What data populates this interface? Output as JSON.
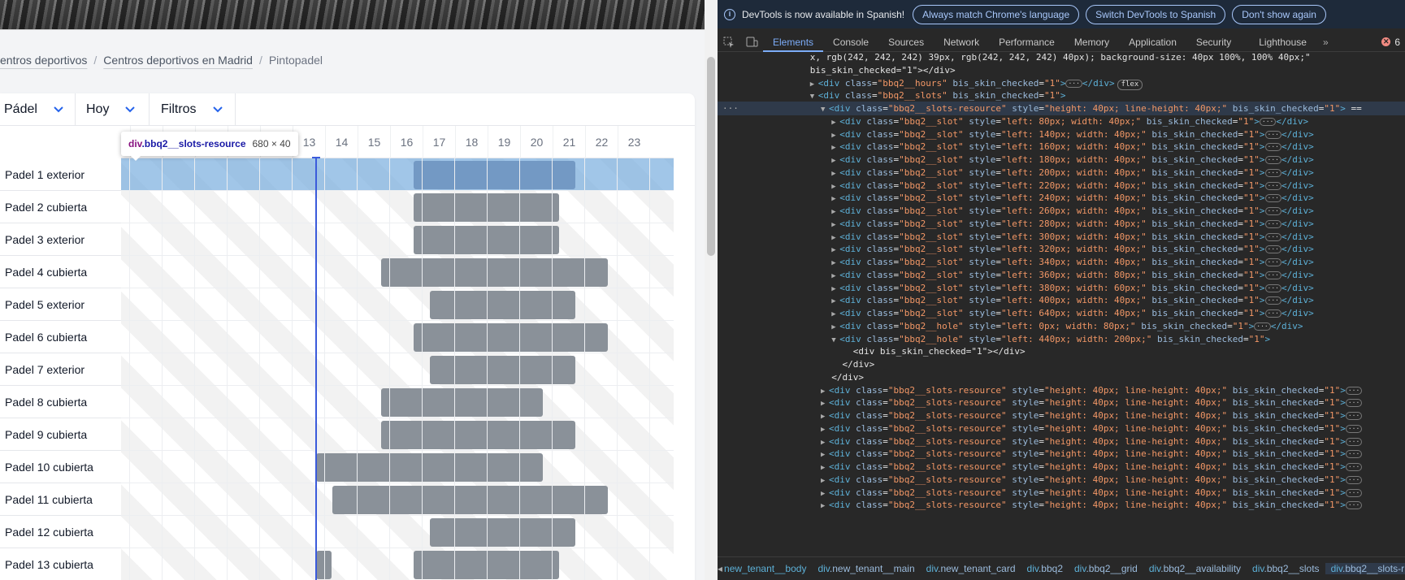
{
  "breadcrumb": {
    "items": [
      "entros deportivos",
      "Centros deportivos en Madrid",
      "Pintopadel"
    ],
    "separator": "/"
  },
  "filters": [
    {
      "label": "Pádel"
    },
    {
      "label": "Hoy"
    },
    {
      "label": "Filtros"
    }
  ],
  "hours": [
    "",
    "",
    "",
    "",
    "",
    "13",
    "14",
    "15",
    "16",
    "17",
    "18",
    "19",
    "20",
    "21",
    "22",
    "23"
  ],
  "resources": [
    "Padel 1 exterior",
    "Padel 2 cubierta",
    "Padel 3 exterior",
    "Padel 4 cubierta",
    "Padel 5 exterior",
    "Padel 6 cubierta",
    "Padel 7 exterior",
    "Padel 8 cubierta",
    "Padel 9 cubierta",
    "Padel 10 cubierta",
    "Padel 11 cubierta",
    "Padel 12 cubierta",
    "Padel 13 cubierta"
  ],
  "bookings": [
    [
      {
        "start": 18,
        "end": 23
      }
    ],
    [
      {
        "start": 18,
        "end": 22.5
      }
    ],
    [
      {
        "start": 18,
        "end": 22.5
      }
    ],
    [
      {
        "start": 17,
        "end": 24
      }
    ],
    [
      {
        "start": 18.5,
        "end": 23
      }
    ],
    [
      {
        "start": 18,
        "end": 24
      }
    ],
    [
      {
        "start": 18.5,
        "end": 23
      }
    ],
    [
      {
        "start": 17,
        "end": 22
      }
    ],
    [
      {
        "start": 17,
        "end": 23
      }
    ],
    [
      {
        "start": 15,
        "end": 22
      }
    ],
    [
      {
        "start": 15.5,
        "end": 24
      }
    ],
    [
      {
        "start": 18.5,
        "end": 23
      }
    ],
    [
      {
        "start": 15,
        "end": 15.5
      },
      {
        "start": 18,
        "end": 22.5
      }
    ]
  ],
  "now_hour": 15,
  "tooltip": {
    "tag": "div",
    "cls": ".bbq2__slots-resource",
    "dims": "680 × 40"
  },
  "devtools": {
    "infobar": {
      "message": "DevTools is now available in Spanish!",
      "buttons": [
        "Always match Chrome's language",
        "Switch DevTools to Spanish",
        "Don't show again"
      ]
    },
    "tabs": [
      "Elements",
      "Console",
      "Sources",
      "Network",
      "Performance",
      "Memory",
      "Application",
      "Security",
      "Lighthouse"
    ],
    "active_tab": "Elements",
    "error_count": "6",
    "dom_lines": [
      {
        "indent": 19,
        "text": "x, rgb(242, 242, 242) 39px, rgb(242, 242, 242) 40px); background-size: 40px 100%, 100% 40px;\"",
        "raw": true
      },
      {
        "indent": 19,
        "text": "bis_skin_checked=\"1\"></div>",
        "raw": true
      },
      {
        "indent": 19,
        "arrow": "▶",
        "cls": "bbq2__hours",
        "rest": " bis_skin_checked=\"1\">",
        "tail": "</div>",
        "ell": true,
        "flex": true
      },
      {
        "indent": 19,
        "arrow": "▼",
        "cls": "bbq2__slots",
        "rest": " bis_skin_checked=\"1\">"
      },
      {
        "indent": 21,
        "arrow": "▼",
        "cls": "bbq2__slots-resource",
        "style": "height: 40px; line-height: 40px;",
        "rest": " bis_skin_checked=\"1\"> ==",
        "selected": true
      },
      {
        "indent": 23,
        "arrow": "▶",
        "cls": "bbq2__slot",
        "style": "left: 80px; width: 40px;",
        "ell": true
      },
      {
        "indent": 23,
        "arrow": "▶",
        "cls": "bbq2__slot",
        "style": "left: 140px; width: 40px;",
        "ell": true
      },
      {
        "indent": 23,
        "arrow": "▶",
        "cls": "bbq2__slot",
        "style": "left: 160px; width: 40px;",
        "ell": true
      },
      {
        "indent": 23,
        "arrow": "▶",
        "cls": "bbq2__slot",
        "style": "left: 180px; width: 40px;",
        "ell": true
      },
      {
        "indent": 23,
        "arrow": "▶",
        "cls": "bbq2__slot",
        "style": "left: 200px; width: 40px;",
        "ell": true
      },
      {
        "indent": 23,
        "arrow": "▶",
        "cls": "bbq2__slot",
        "style": "left: 220px; width: 40px;",
        "ell": true
      },
      {
        "indent": 23,
        "arrow": "▶",
        "cls": "bbq2__slot",
        "style": "left: 240px; width: 40px;",
        "ell": true
      },
      {
        "indent": 23,
        "arrow": "▶",
        "cls": "bbq2__slot",
        "style": "left: 260px; width: 40px;",
        "ell": true
      },
      {
        "indent": 23,
        "arrow": "▶",
        "cls": "bbq2__slot",
        "style": "left: 280px; width: 40px;",
        "ell": true
      },
      {
        "indent": 23,
        "arrow": "▶",
        "cls": "bbq2__slot",
        "style": "left: 300px; width: 40px;",
        "ell": true
      },
      {
        "indent": 23,
        "arrow": "▶",
        "cls": "bbq2__slot",
        "style": "left: 320px; width: 40px;",
        "ell": true
      },
      {
        "indent": 23,
        "arrow": "▶",
        "cls": "bbq2__slot",
        "style": "left: 340px; width: 40px;",
        "ell": true
      },
      {
        "indent": 23,
        "arrow": "▶",
        "cls": "bbq2__slot",
        "style": "left: 360px; width: 80px;",
        "ell": true
      },
      {
        "indent": 23,
        "arrow": "▶",
        "cls": "bbq2__slot",
        "style": "left: 380px; width: 60px;",
        "ell": true
      },
      {
        "indent": 23,
        "arrow": "▶",
        "cls": "bbq2__slot",
        "style": "left: 400px; width: 40px;",
        "ell": true
      },
      {
        "indent": 23,
        "arrow": "▶",
        "cls": "bbq2__slot",
        "style": "left: 640px; width: 40px;",
        "ell": true
      },
      {
        "indent": 23,
        "arrow": "▶",
        "cls": "bbq2__hole",
        "style": "left: 0px; width: 80px;",
        "ell": true
      },
      {
        "indent": 23,
        "arrow": "▼",
        "cls": "bbq2__hole",
        "style": "left: 440px; width: 200px;",
        "rest": " bis_skin_checked=\"1\">"
      },
      {
        "indent": 27,
        "text": "<div bis_skin_checked=\"1\"></div>",
        "raw": true,
        "tagged": true
      },
      {
        "indent": 25,
        "text": "</div>",
        "raw": true,
        "tagged": true
      },
      {
        "indent": 23,
        "text": "</div>",
        "raw": true,
        "tagged": true
      },
      {
        "indent": 21,
        "arrow": "▶",
        "cls": "bbq2__slots-resource",
        "style": "height: 40px; line-height: 40px;",
        "rest": " bis_skin_checked=\"1\">",
        "ell": true
      },
      {
        "indent": 21,
        "arrow": "▶",
        "cls": "bbq2__slots-resource",
        "style": "height: 40px; line-height: 40px;",
        "rest": " bis_skin_checked=\"1\">",
        "ell": true
      },
      {
        "indent": 21,
        "arrow": "▶",
        "cls": "bbq2__slots-resource",
        "style": "height: 40px; line-height: 40px;",
        "rest": " bis_skin_checked=\"1\">",
        "ell": true
      },
      {
        "indent": 21,
        "arrow": "▶",
        "cls": "bbq2__slots-resource",
        "style": "height: 40px; line-height: 40px;",
        "rest": " bis_skin_checked=\"1\">",
        "ell": true
      },
      {
        "indent": 21,
        "arrow": "▶",
        "cls": "bbq2__slots-resource",
        "style": "height: 40px; line-height: 40px;",
        "rest": " bis_skin_checked=\"1\">",
        "ell": true
      },
      {
        "indent": 21,
        "arrow": "▶",
        "cls": "bbq2__slots-resource",
        "style": "height: 40px; line-height: 40px;",
        "rest": " bis_skin_checked=\"1\">",
        "ell": true
      },
      {
        "indent": 21,
        "arrow": "▶",
        "cls": "bbq2__slots-resource",
        "style": "height: 40px; line-height: 40px;",
        "rest": " bis_skin_checked=\"1\">",
        "ell": true
      },
      {
        "indent": 21,
        "arrow": "▶",
        "cls": "bbq2__slots-resource",
        "style": "height: 40px; line-height: 40px;",
        "rest": " bis_skin_checked=\"1\">",
        "ell": true
      },
      {
        "indent": 21,
        "arrow": "▶",
        "cls": "bbq2__slots-resource",
        "style": "height: 40px; line-height: 40px;",
        "rest": " bis_skin_checked=\"1\">",
        "ell": true
      },
      {
        "indent": 21,
        "arrow": "▶",
        "cls": "bbq2__slots-resource",
        "style": "height: 40px; line-height: 40px;",
        "rest": " bis_skin_checked=\"1\">",
        "ell": true
      }
    ],
    "breadcrumbs": [
      {
        "tag": "div",
        "cls": ".new_tenant__body",
        "display": "new_tenant__body",
        "partial": true
      },
      {
        "tag": "div",
        "cls": ".new_tenant__main"
      },
      {
        "tag": "div",
        "cls": ".new_tenant_card"
      },
      {
        "tag": "div",
        "cls": ".bbq2"
      },
      {
        "tag": "div",
        "cls": ".bbq2__grid"
      },
      {
        "tag": "div",
        "cls": ".bbq2__availability"
      },
      {
        "tag": "div",
        "cls": ".bbq2__slots"
      },
      {
        "tag": "div",
        "cls": ".bbq2__slots-r",
        "active": true
      }
    ]
  }
}
